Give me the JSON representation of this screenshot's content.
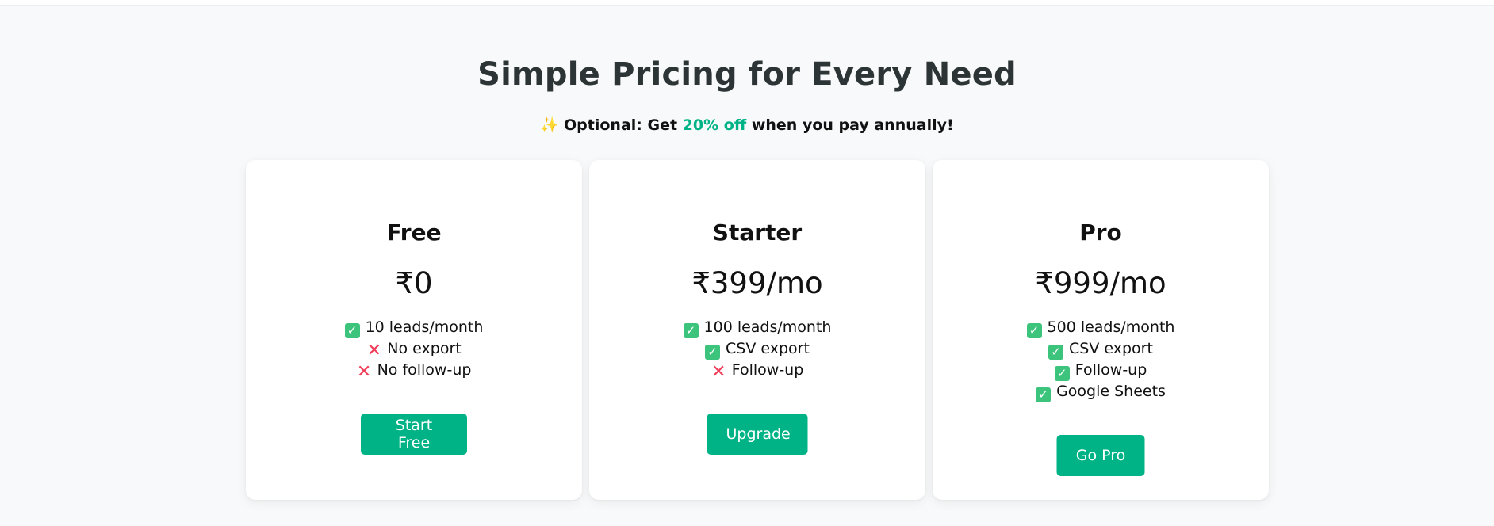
{
  "header": {
    "title": "Simple Pricing for Every Need",
    "subtitle_icon": "✨",
    "subtitle_prefix": "Optional: Get ",
    "subtitle_highlight": "20% off",
    "subtitle_suffix": " when you pay annually!"
  },
  "colors": {
    "accent": "#00b386",
    "check": "#3cc47c",
    "cross": "#f03c5a",
    "background": "#f8f9fa"
  },
  "plans": [
    {
      "name": "Free",
      "price": "₹0",
      "features": [
        {
          "included": true,
          "icon": "check-icon",
          "text": "10 leads/month"
        },
        {
          "included": false,
          "icon": "cross-icon",
          "text": "No export"
        },
        {
          "included": false,
          "icon": "cross-icon",
          "text": "No follow-up"
        }
      ],
      "button": "Start Free"
    },
    {
      "name": "Starter",
      "price": "₹399/mo",
      "features": [
        {
          "included": true,
          "icon": "check-icon",
          "text": "100 leads/month"
        },
        {
          "included": true,
          "icon": "check-icon",
          "text": "CSV export"
        },
        {
          "included": false,
          "icon": "cross-icon",
          "text": "Follow-up"
        }
      ],
      "button": "Upgrade"
    },
    {
      "name": "Pro",
      "price": "₹999/mo",
      "features": [
        {
          "included": true,
          "icon": "check-icon",
          "text": "500 leads/month"
        },
        {
          "included": true,
          "icon": "check-icon",
          "text": "CSV export"
        },
        {
          "included": true,
          "icon": "check-icon",
          "text": "Follow-up"
        },
        {
          "included": true,
          "icon": "check-icon",
          "text": "Google Sheets"
        }
      ],
      "button": "Go Pro"
    }
  ]
}
